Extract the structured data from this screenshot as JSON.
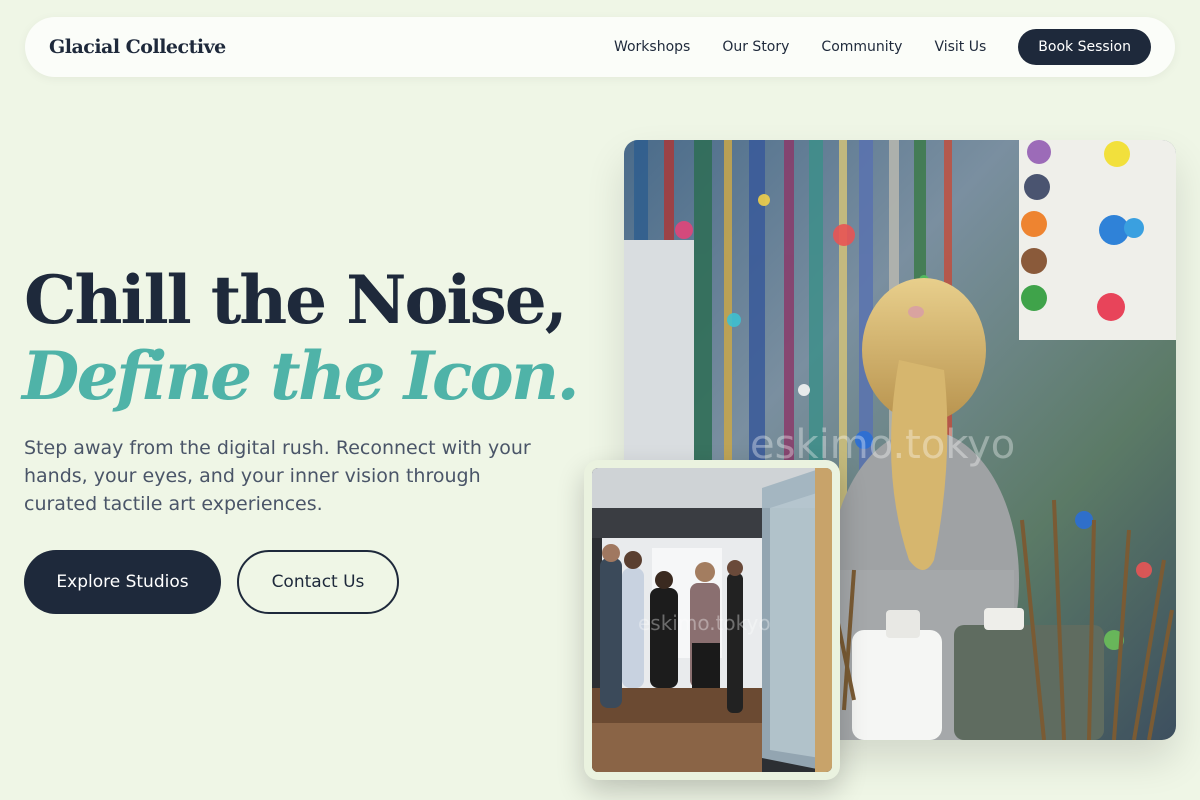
{
  "nav": {
    "brand": "Glacial Collective",
    "links": [
      "Workshops",
      "Our Story",
      "Community",
      "Visit Us"
    ],
    "cta": "Book Session"
  },
  "hero": {
    "title_line1": "Chill the Noise,",
    "title_line2": "Define the Icon.",
    "subtitle": "Step away from the digital rush. Reconnect with your hands, your eyes, and your inner vision through curated tactile art experiences.",
    "primary_button": "Explore Studios",
    "secondary_button": "Contact Us"
  },
  "images": {
    "main_watermark": "eskimo.tokyo",
    "inset_watermark": "eskimo.tokyo"
  },
  "colors": {
    "background": "#eff6e6",
    "navy": "#1e293b",
    "accent": "#4fb3a8",
    "body_text": "#4a5568"
  }
}
